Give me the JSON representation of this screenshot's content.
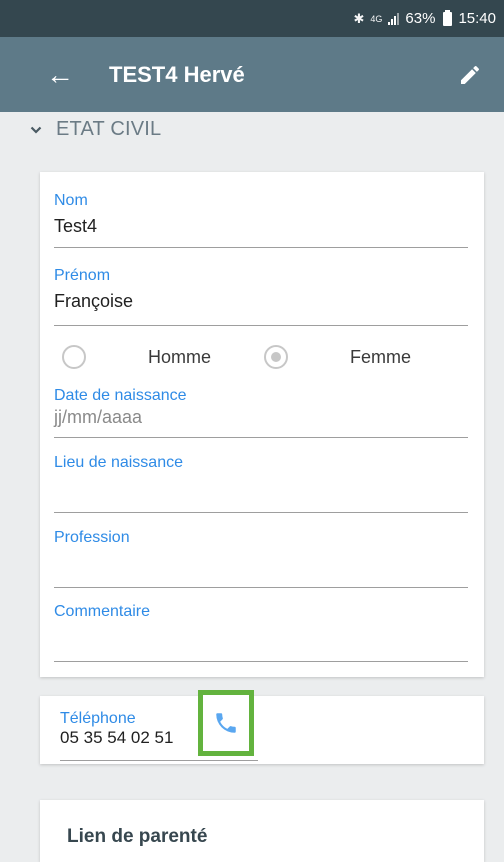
{
  "status_bar": {
    "bluetooth": "✱",
    "network": "4G",
    "battery": "63%",
    "time": "15:40"
  },
  "app_bar": {
    "back_glyph": "←",
    "title": "TEST4 Hervé"
  },
  "section": {
    "title": "ETAT CIVIL"
  },
  "etat_civil": {
    "nom": {
      "label": "Nom",
      "value": "Test4"
    },
    "prenom": {
      "label": "Prénom",
      "value": "Françoise"
    },
    "gender": {
      "options": [
        {
          "label": "Homme",
          "selected": false
        },
        {
          "label": "Femme",
          "selected": true
        }
      ]
    },
    "date_naissance": {
      "label": "Date de naissance",
      "placeholder": "jj/mm/aaaa"
    },
    "lieu_naissance": {
      "label": "Lieu de naissance",
      "value": ""
    },
    "profession": {
      "label": "Profession",
      "value": ""
    },
    "commentaire": {
      "label": "Commentaire",
      "value": ""
    }
  },
  "telephone": {
    "label": "Téléphone",
    "value": "05 35 54 02 51"
  },
  "lien": {
    "title": "Lien de parenté"
  },
  "colors": {
    "status_bar": "#34474f",
    "app_bar": "#5e7a88",
    "accent_label": "#2f8be6",
    "phone_icon": "#5aa7f0",
    "highlight": "#63b33e"
  },
  "icons": [
    "bluetooth-icon",
    "signal-icon",
    "battery-icon",
    "back-arrow-icon",
    "pencil-icon",
    "chevron-down-icon",
    "phone-icon"
  ]
}
